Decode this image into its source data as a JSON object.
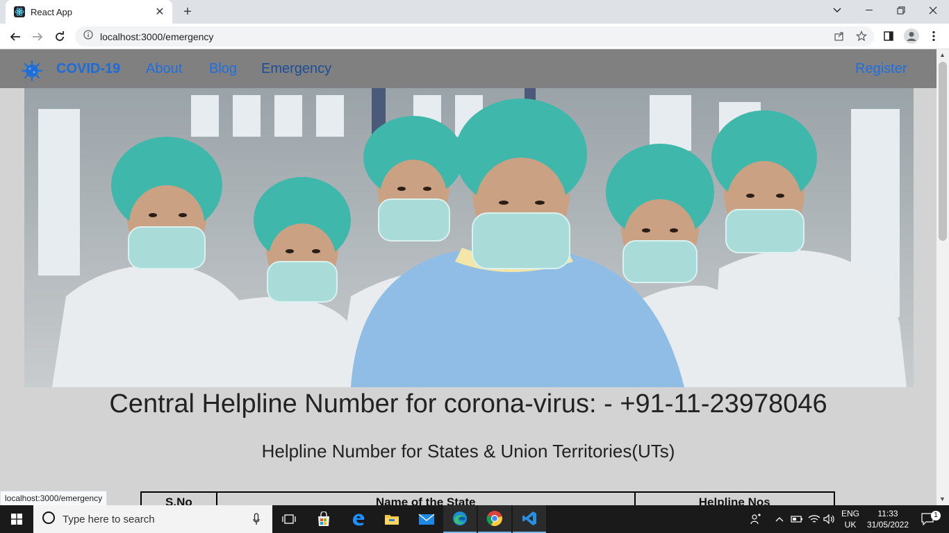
{
  "browser": {
    "tab_title": "React App",
    "tab_close": "✕",
    "new_tab": "+",
    "url": "localhost:3000/emergency",
    "status_url": "localhost:3000/emergency"
  },
  "navbar": {
    "brand": "COVID-19",
    "links": [
      "About",
      "Blog",
      "Emergency"
    ],
    "register": "Register"
  },
  "main": {
    "heading": "Central Helpline Number for corona-virus: - +91-11-23978046",
    "subheading": "Helpline Number for States & Union Territories(UTs)",
    "table_headers": [
      "S.No",
      "Name of the State",
      "Helpline Nos"
    ]
  },
  "taskbar": {
    "search_placeholder": "Type here to search",
    "lang_line1": "ENG",
    "lang_line2": "UK",
    "time": "11:33",
    "date": "31/05/2022",
    "notification_count": "1"
  },
  "colors": {
    "navbar_bg": "#808080",
    "nav_link": "#1d6fe0",
    "page_bg": "#d3d3d3"
  }
}
